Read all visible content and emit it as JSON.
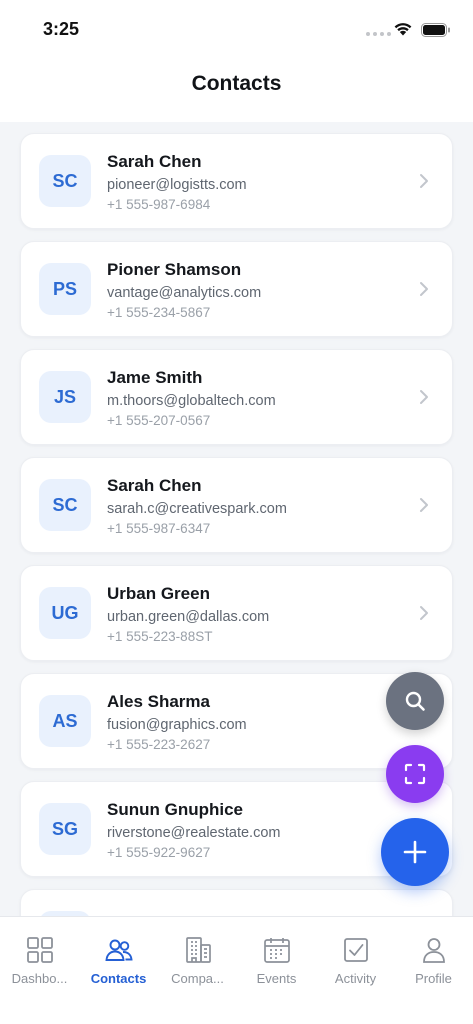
{
  "status_bar": {
    "time": "3:25"
  },
  "header": {
    "title": "Contacts"
  },
  "contacts": [
    {
      "initials": "SC",
      "name": "Sarah Chen",
      "email": "pioneer@logistts.com",
      "phone": "+1 555-987-6984"
    },
    {
      "initials": "PS",
      "name": "Pioner Shamson",
      "email": "vantage@analytics.com",
      "phone": "+1 555-234-5867"
    },
    {
      "initials": "JS",
      "name": "Jame Smith",
      "email": "m.thoors@globaltech.com",
      "phone": "+1 555-207-0567"
    },
    {
      "initials": "SC",
      "name": "Sarah Chen",
      "email": "sarah.c@creativespark.com",
      "phone": "+1 555-987-6347"
    },
    {
      "initials": "UG",
      "name": "Urban Green",
      "email": "urban.green@dallas.com",
      "phone": "+1 555-223-88ST"
    },
    {
      "initials": "AS",
      "name": "Ales Sharma",
      "email": "fusion@graphics.com",
      "phone": "+1 555-223-2627"
    },
    {
      "initials": "SG",
      "name": "Sunun Gnuphice",
      "email": "riverstone@realestate.com",
      "phone": "+1 555-922-9627"
    }
  ],
  "fabs": {
    "search_icon": "search-icon",
    "scan_icon": "scan-icon",
    "add_icon": "plus-icon"
  },
  "tabs": [
    {
      "label": "Dashbo...",
      "icon": "dashboard-icon"
    },
    {
      "label": "Contacts",
      "icon": "contacts-icon"
    },
    {
      "label": "Compa...",
      "icon": "building-icon"
    },
    {
      "label": "Events",
      "icon": "calendar-icon"
    },
    {
      "label": "Activity",
      "icon": "checkbox-icon"
    },
    {
      "label": "Profile",
      "icon": "person-icon"
    }
  ],
  "active_tab": "Contacts",
  "colors": {
    "accent": "#2563eb",
    "avatar_bg": "#e9f1fd",
    "avatar_text": "#2d6bd3",
    "scan_fab": "#8a3cf0",
    "search_fab": "#6b7280",
    "background": "#f3f5f8"
  }
}
